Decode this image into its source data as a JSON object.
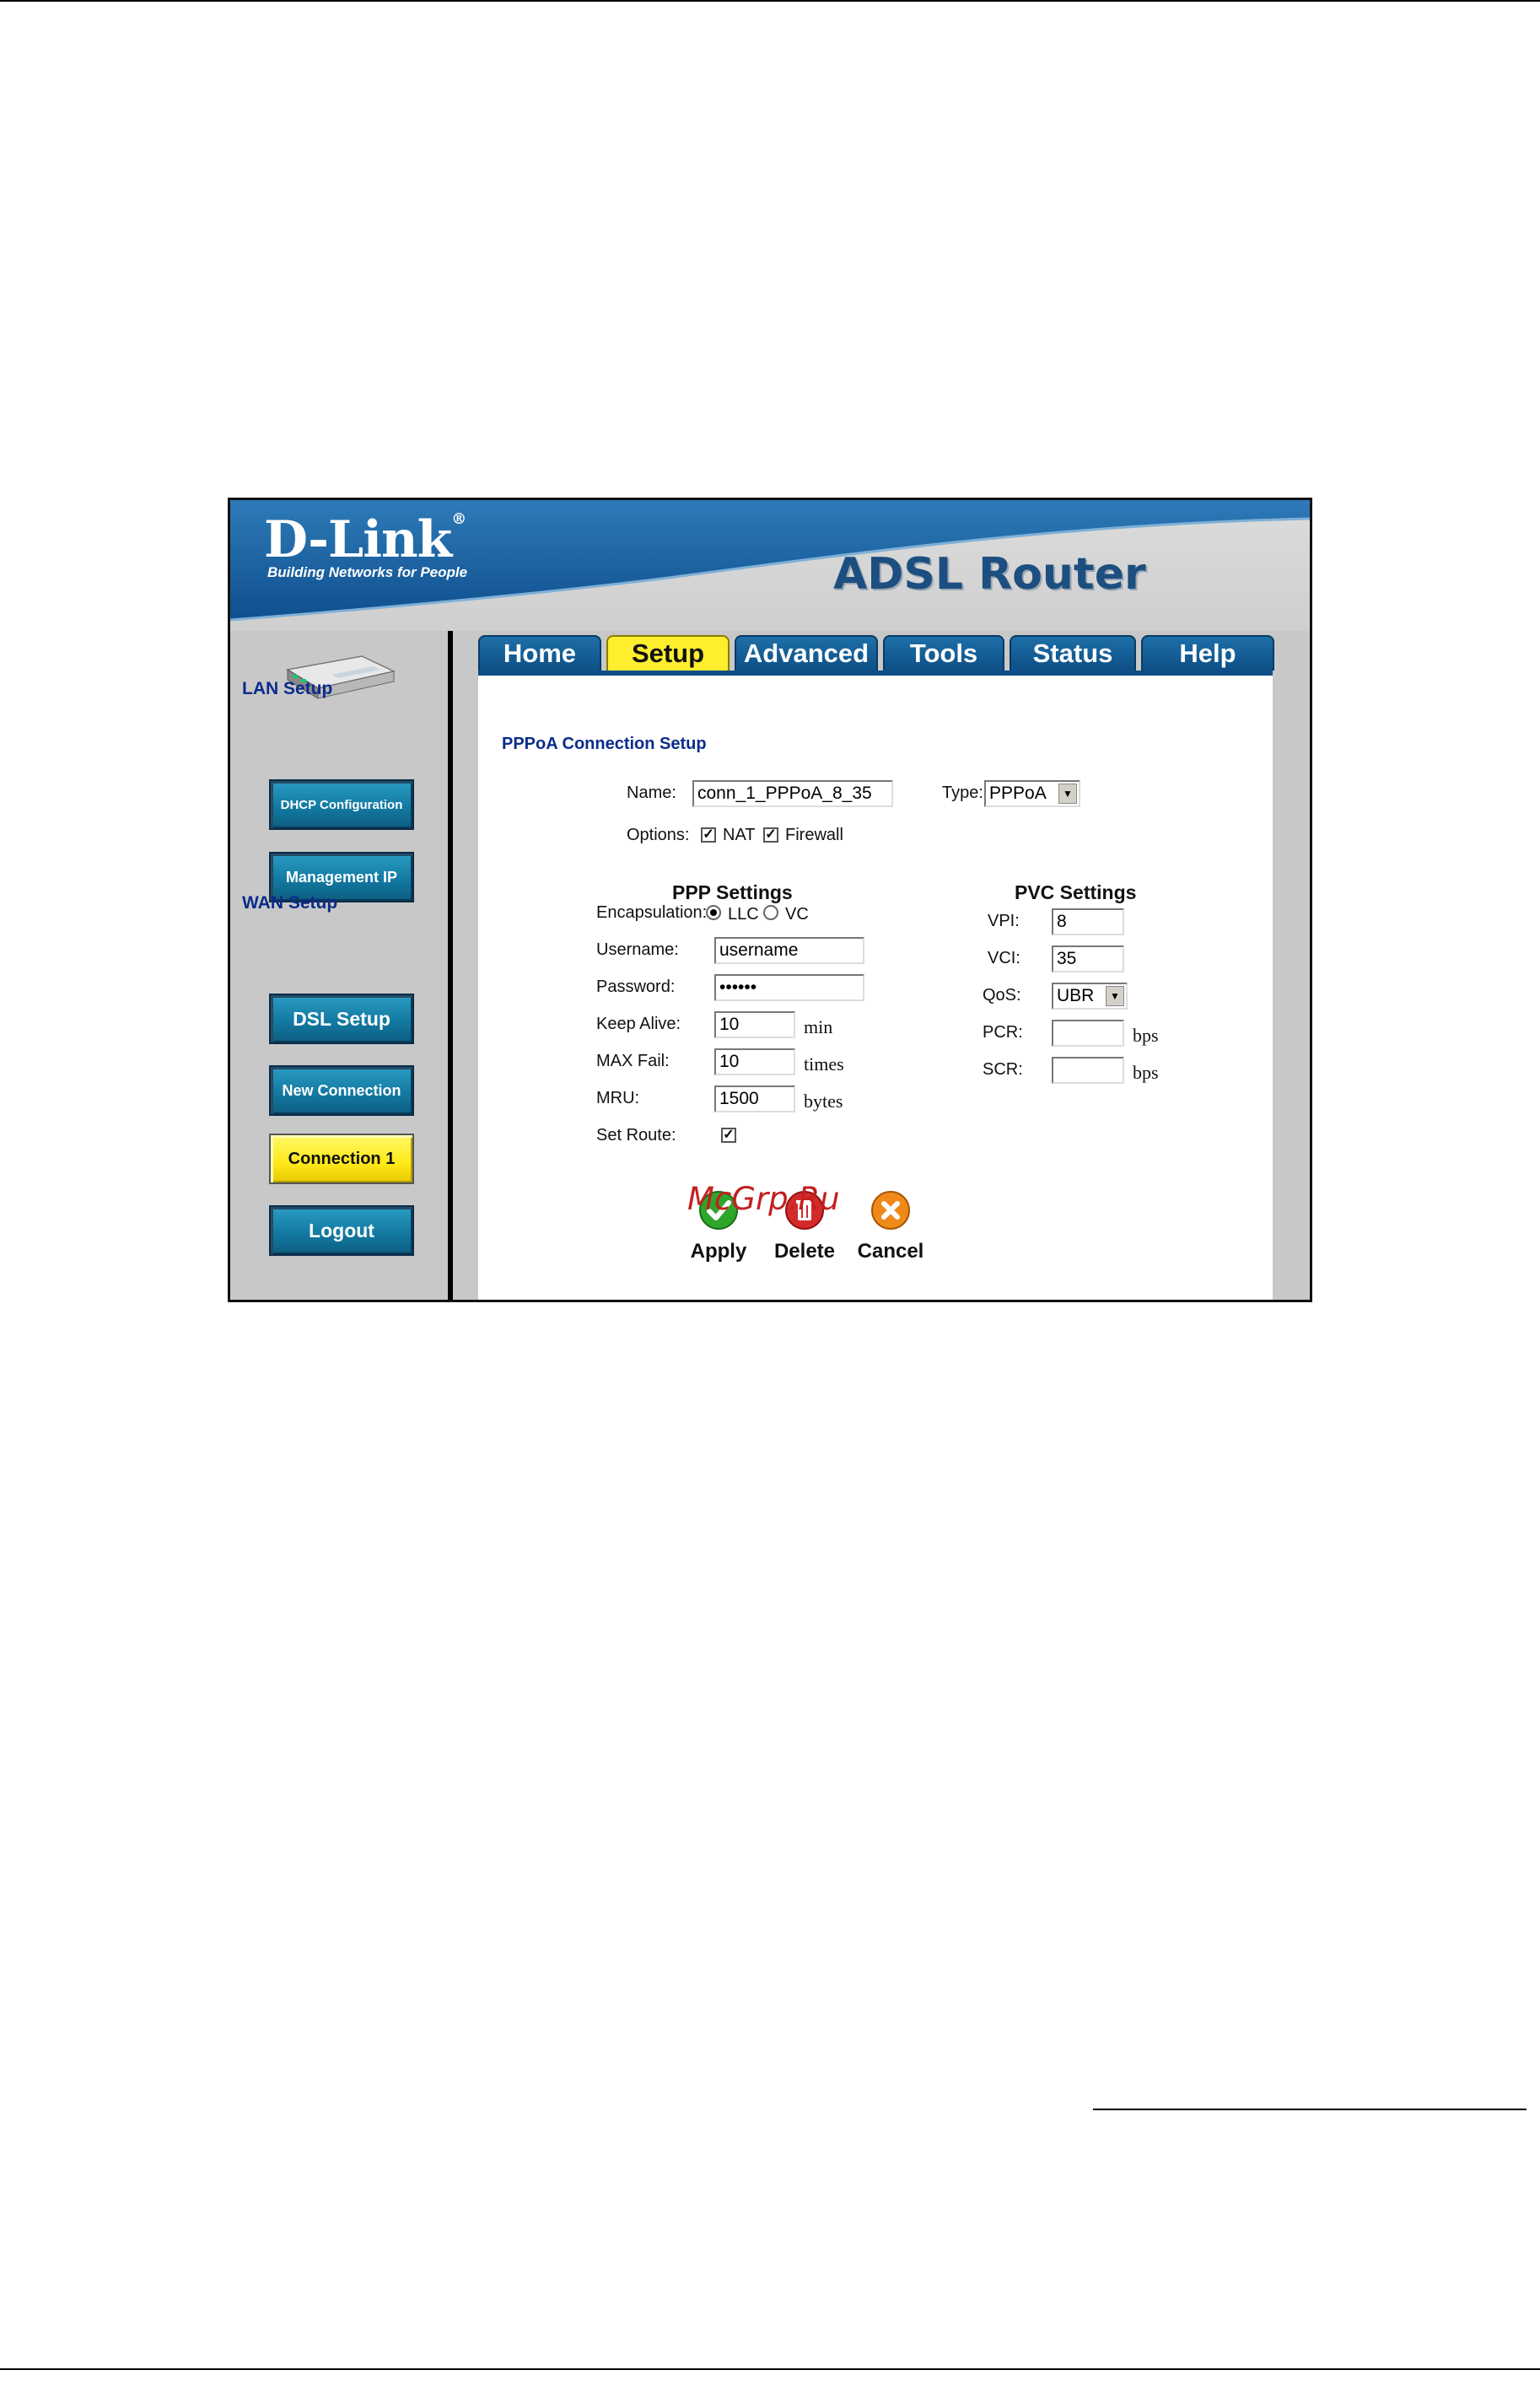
{
  "brand": {
    "logo": "D-Link",
    "logo_reg": "®",
    "tagline": "Building Networks for People",
    "product": "ADSL Router"
  },
  "tabs": [
    {
      "label": "Home"
    },
    {
      "label": "Setup",
      "active": true
    },
    {
      "label": "Advanced"
    },
    {
      "label": "Tools"
    },
    {
      "label": "Status"
    },
    {
      "label": "Help"
    }
  ],
  "sidebar": {
    "lan_heading": "LAN Setup",
    "wan_heading": "WAN Setup",
    "buttons": [
      {
        "label": "DHCP Configuration"
      },
      {
        "label": "Management IP"
      },
      {
        "label": "DSL Setup"
      },
      {
        "label": "New Connection"
      },
      {
        "label": "Connection 1",
        "active": true
      },
      {
        "label": "Logout"
      }
    ]
  },
  "form": {
    "title": "PPPoA Connection Setup",
    "name_label": "Name:",
    "name_value": "conn_1_PPPoA_8_35",
    "type_label": "Type:",
    "type_value": "PPPoA",
    "options_label": "Options:",
    "nat_label": "NAT",
    "firewall_label": "Firewall",
    "ppp_heading": "PPP Settings",
    "pvc_heading": "PVC Settings",
    "encap_label": "Encapsulation:",
    "llc_label": "LLC",
    "vc_label": "VC",
    "username_label": "Username:",
    "username_value": "username",
    "password_label": "Password:",
    "password_value": "******",
    "keepalive_label": "Keep Alive:",
    "keepalive_value": "10",
    "keepalive_unit": "min",
    "maxfail_label": "MAX Fail:",
    "maxfail_value": "10",
    "maxfail_unit": "times",
    "mru_label": "MRU:",
    "mru_value": "1500",
    "mru_unit": "bytes",
    "setroute_label": "Set Route:",
    "vpi_label": "VPI:",
    "vpi_value": "8",
    "vci_label": "VCI:",
    "vci_value": "35",
    "qos_label": "QoS:",
    "qos_value": "UBR",
    "pcr_label": "PCR:",
    "pcr_unit": "bps",
    "scr_label": "SCR:",
    "scr_unit": "bps"
  },
  "actions": {
    "apply": "Apply",
    "delete": "Delete",
    "cancel": "Cancel"
  },
  "watermark": "McGrp.Ru"
}
